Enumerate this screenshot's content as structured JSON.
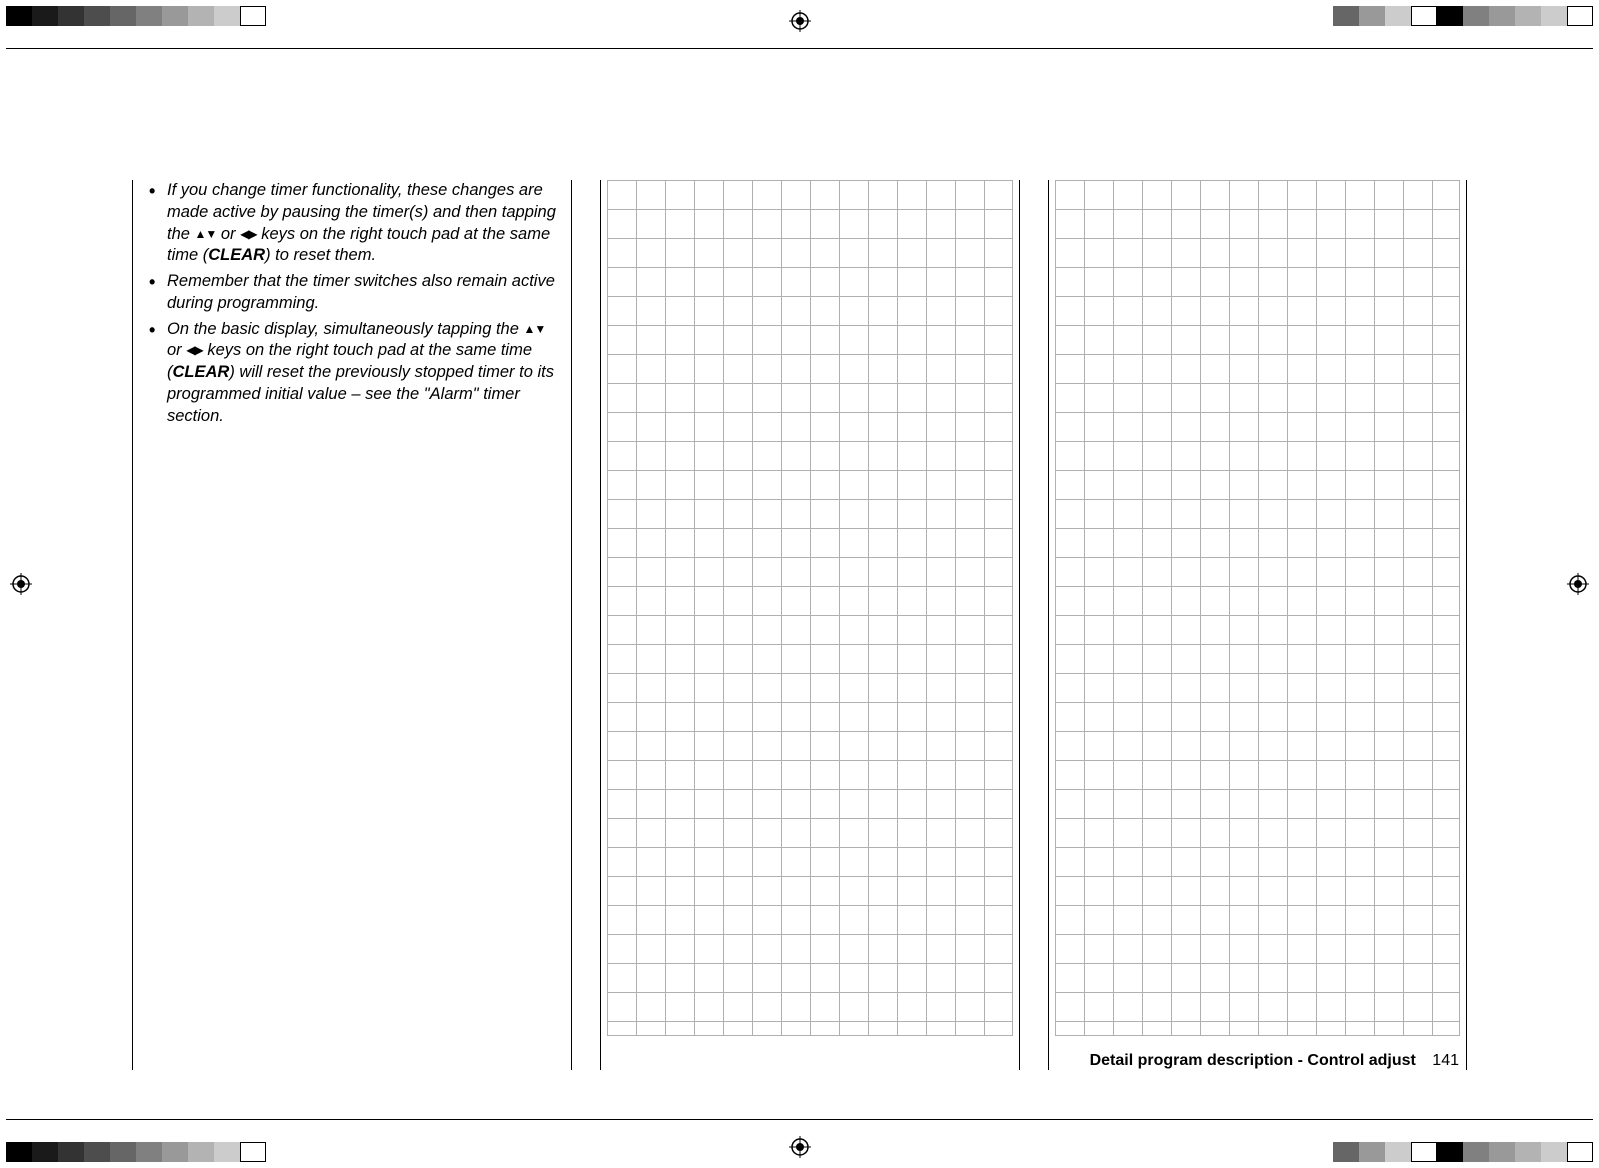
{
  "swatches_left": [
    "#000000",
    "#1a1a1a",
    "#333333",
    "#4d4d4d",
    "#666666",
    "#808080",
    "#999999",
    "#b3b3b3",
    "#cccccc",
    "#ffffff"
  ],
  "swatches_right": [
    "#ffffff",
    "#cccccc",
    "#b3b3b3",
    "#999999",
    "#808080",
    "#000000",
    "#ffffff",
    "#cccccc",
    "#999999",
    "#666666"
  ],
  "bullets": {
    "b1": {
      "pre": "If you change timer functionality, these changes are made active by pausing the timer(s) and then tapping the ",
      "arrows1": "▲▼",
      "mid1": " or ",
      "arrows2": "◀▶",
      "mid2": " keys on the right touch pad at the same time (",
      "bold": "CLEAR",
      "post": ") to reset them."
    },
    "b2": "Remember that the timer switches also remain active during programming.",
    "b3": {
      "pre": "On the basic display, simultaneously tapping the ",
      "arrows1": "▲▼",
      "mid1": " or ",
      "arrows2": "◀▶",
      "mid2": " keys on the right touch pad at the same time (",
      "bold": "CLEAR",
      "post": ") will reset the previously stopped timer to its programmed initial value – see the \"Alarm\" timer section."
    }
  },
  "footer": {
    "title": "Detail program description - Control adjust",
    "page_number": "141"
  }
}
